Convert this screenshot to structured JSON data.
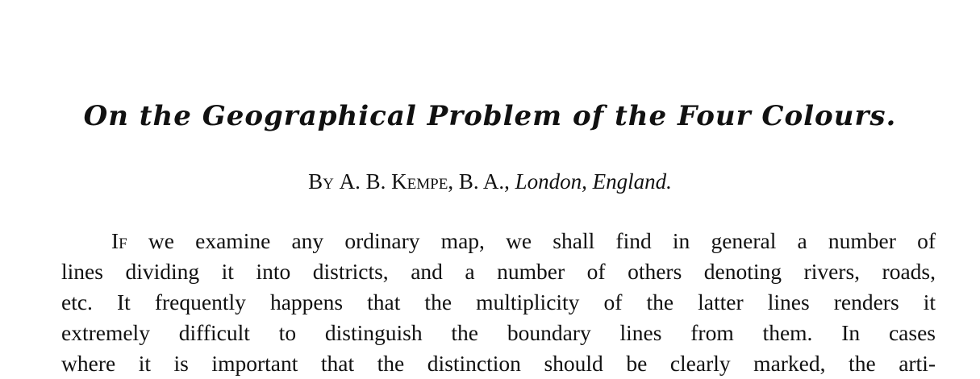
{
  "title": "On the Geographical Problem of the Four Colours.",
  "byline": {
    "prefix": "By",
    "author": "A. B. Kempe",
    "degree": ", B. A., ",
    "location": "London, England."
  },
  "paragraph": {
    "dropcap": "If",
    "lines": [
      " we examine any ordinary map, we shall find in general a number of",
      "lines dividing it into districts, and a number of others denoting rivers, roads,",
      "etc.  It frequently happens that the multiplicity of the latter lines renders it",
      "extremely difficult to distinguish the boundary lines from them.  In cases",
      "where it is important that the distinction should be clearly marked, the arti-"
    ]
  }
}
